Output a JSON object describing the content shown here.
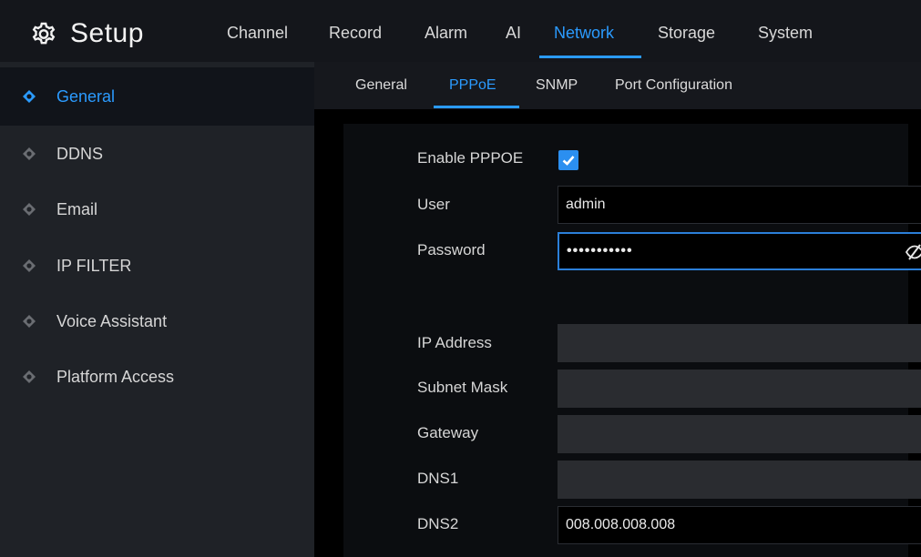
{
  "header": {
    "title": "Setup",
    "icon": "gear-icon",
    "nav": [
      {
        "label": "Channel"
      },
      {
        "label": "Record"
      },
      {
        "label": "Alarm"
      },
      {
        "label": "AI"
      },
      {
        "label": "Network",
        "active": true
      },
      {
        "label": "Storage"
      },
      {
        "label": "System"
      }
    ]
  },
  "sidebar": {
    "items": [
      {
        "label": "General",
        "active": true
      },
      {
        "label": "DDNS"
      },
      {
        "label": "Email"
      },
      {
        "label": "IP FILTER"
      },
      {
        "label": "Voice Assistant"
      },
      {
        "label": "Platform Access"
      }
    ]
  },
  "subtabs": [
    {
      "label": "General"
    },
    {
      "label": "PPPoE",
      "active": true
    },
    {
      "label": "SNMP"
    },
    {
      "label": "Port Configuration"
    }
  ],
  "form": {
    "enable_label": "Enable PPPOE",
    "enable_checked": true,
    "user_label": "User",
    "user_value": "admin",
    "password_label": "Password",
    "password_value": "•••••••••••",
    "ip_label": "IP Address",
    "ip_value": "",
    "subnet_label": "Subnet Mask",
    "subnet_value": "",
    "gateway_label": "Gateway",
    "gateway_value": "",
    "dns1_label": "DNS1",
    "dns1_value": "",
    "dns2_label": "DNS2",
    "dns2_value": "008.008.008.008"
  },
  "colors": {
    "accent": "#2b9bff",
    "sidebar_bg": "#1f2227",
    "topbar_bg": "#14161b"
  }
}
